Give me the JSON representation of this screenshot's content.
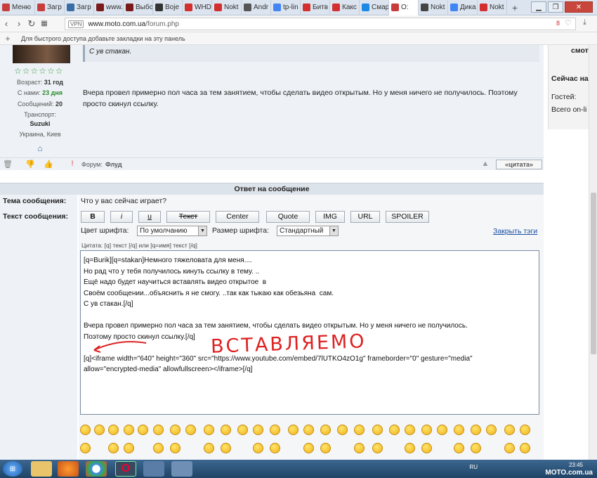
{
  "tabs": [
    {
      "label": "Меню",
      "color": "#c83c3c"
    },
    {
      "label": "Загр",
      "color": "#c83c3c"
    },
    {
      "label": "Загр",
      "color": "#3a6ea5"
    },
    {
      "label": "www.",
      "color": "#7a1a1a"
    },
    {
      "label": "Выбо",
      "color": "#7a1a1a"
    },
    {
      "label": "Вoje",
      "color": "#333333"
    },
    {
      "label": "WHD",
      "color": "#d32f2f"
    },
    {
      "label": "Nokt",
      "color": "#d32f2f"
    },
    {
      "label": "Andr",
      "color": "#555555"
    },
    {
      "label": "tp-lin",
      "color": "#4285f4"
    },
    {
      "label": "Битв",
      "color": "#d32f2f"
    },
    {
      "label": "Какс",
      "color": "#d32f2f"
    },
    {
      "label": "Смар",
      "color": "#1e88e5"
    },
    {
      "label": "O:",
      "color": "#c83c3c"
    },
    {
      "label": "Nokt",
      "color": "#444444"
    },
    {
      "label": "Дика",
      "color": "#4285f4"
    },
    {
      "label": "Nokt",
      "color": "#d32f2f"
    }
  ],
  "browser": {
    "url_host": "www.moto.com.ua",
    "url_path": "/forum.php",
    "vpn_label": "VPN",
    "bookmark_hint": "Для быстрого доступа добавьте закладки на эту панель",
    "badge_count": "8"
  },
  "user": {
    "age_label": "Возраст:",
    "age_value": "31 год",
    "member_label": "С нами:",
    "member_value": "23 дня",
    "posts_label": "Сообщений:",
    "posts_value": "20",
    "transport_label": "Транспорт:",
    "transport_value": "Suzuki",
    "location": "Украина, Киев"
  },
  "post": {
    "quote_text": "С ув стакан.",
    "body": "Вчера провел примерно пол часа за тем занятием, чтобы сделать видео открытым. Но у меня ничего не получилось. Поэтому просто скинул ссылку.",
    "forum_label": "Форум:",
    "forum_value": "Флуд",
    "cite_button": "«цитата»"
  },
  "sidebar": {
    "top_text": "смот|",
    "title": "Сейчас на",
    "guests": "Гостей:",
    "total": "Всего on-li"
  },
  "reply": {
    "header": "Ответ на сообщение",
    "subject_label": "Тема сообщения:",
    "subject_value": "Что у вас сейчас играет?",
    "text_label": "Текст сообщения:",
    "buttons": [
      "B",
      "i",
      "u",
      "Текст",
      "Center",
      "Quote",
      "IMG",
      "URL",
      "SPOILER"
    ],
    "font_color_label": "Цвет шрифта:",
    "font_color_value": "По умолчанию",
    "font_size_label": "Размер шрифта:",
    "font_size_value": "Стандартный",
    "close_tags": "Закрыть тэги",
    "hint": "Цитата: [q] текст [/q] или [q=имя] текст [/q]",
    "message_lines": [
      "[q=Burik][q=stakan]Немного тяжеловата для меня....",
      "Но рад что у тебя получилось кинуть ссылку в тему. ..",
      "Ещё надо будет научиться вставлять видео открытое  в",
      "Своём сообщении...объяснить я не смогу. ..так как тыкаю как обезьяна  сам.",
      "С ув стакан.[/q]",
      "",
      "Вчера провел примерно пол часа за тем занятием, чтобы сделать видео открытым. Но у меня ничего не получилось.",
      "Поэтому просто скинул ссылку.[/q]",
      "",
      "[q]<iframe width=\"640\" height=\"360\" src=\"https://www.youtube.com/embed/7lUTKO4zO1g\" frameborder=\"0\" gesture=\"media\"",
      "allow=\"encrypted-media\" allowfullscreen></iframe>[/q]"
    ],
    "annotation": "ВСТАВЛЯЕМО"
  },
  "taskbar": {
    "lang": "RU",
    "time": "23:45",
    "watermark": "MOTO.com.ua"
  }
}
